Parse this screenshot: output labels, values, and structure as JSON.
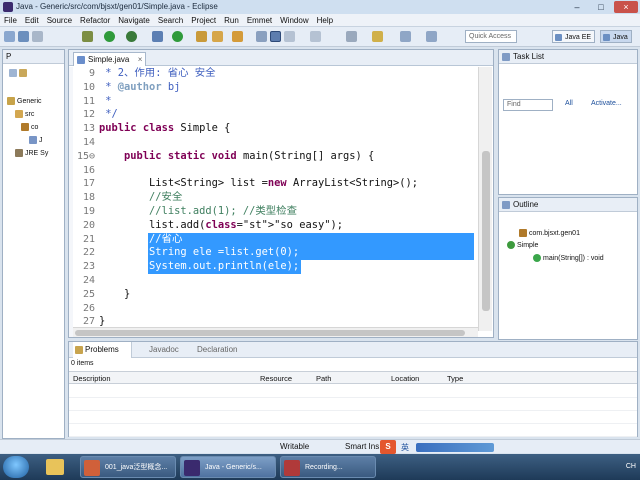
{
  "window": {
    "title": "Java - Generic/src/com/bjsxt/gen01/Simple.java - Eclipse",
    "min": "–",
    "max": "□",
    "close": "×"
  },
  "menu": [
    "File",
    "Edit",
    "Source",
    "Refactor",
    "Navigate",
    "Search",
    "Project",
    "Run",
    "Emmet",
    "Window",
    "Help"
  ],
  "toolbar": {
    "quick_access_placeholder": "Quick Access",
    "perspectives": [
      "Java EE",
      "Java"
    ]
  },
  "package_explorer": {
    "tab": "P",
    "items": [
      "Generic",
      "src",
      "co",
      "J",
      "JRE Sy"
    ]
  },
  "editor": {
    "tab": "Simple.java",
    "lines": [
      {
        "n": "9",
        "code": " * 2、作用: 省心 安全"
      },
      {
        "n": "10",
        "code": " * @author bj"
      },
      {
        "n": "11",
        "code": " *"
      },
      {
        "n": "12",
        "code": " */"
      },
      {
        "n": "13",
        "code": "public class Simple {"
      },
      {
        "n": "14",
        "code": ""
      },
      {
        "n": "15⊖",
        "code": "    public static void main(String[] args) {"
      },
      {
        "n": "16",
        "code": ""
      },
      {
        "n": "17",
        "code": "        List<String> list =new ArrayList<String>();"
      },
      {
        "n": "18",
        "code": "        //安全"
      },
      {
        "n": "19",
        "code": "        //list.add(1); //类型检查"
      },
      {
        "n": "20",
        "code": "        list.add(\"so easy\");"
      },
      {
        "n": "21",
        "code": "        //省心"
      },
      {
        "n": "22",
        "code": "        String ele =list.get(0);"
      },
      {
        "n": "23",
        "code": "        System.out.println(ele);"
      },
      {
        "n": "24",
        "code": ""
      },
      {
        "n": "25",
        "code": "    }"
      },
      {
        "n": "26",
        "code": ""
      },
      {
        "n": "27",
        "code": "}"
      }
    ]
  },
  "task_list": {
    "tab": "Task List",
    "find_placeholder": "Find",
    "all": "All",
    "activate": "Activate..."
  },
  "outline": {
    "tab": "Outline",
    "package": "com.bjsxt.gen01",
    "class": "Simple",
    "method": "main(String[]) : void"
  },
  "problems": {
    "tabs": [
      "Problems",
      "Javadoc",
      "Declaration"
    ],
    "count": "0 items",
    "columns": [
      "Description",
      "Resource",
      "Path",
      "Location",
      "Type"
    ]
  },
  "status": {
    "mode": "Writable",
    "insert": "Smart Ins",
    "ime": "英"
  },
  "taskbar": {
    "apps": [
      "001_java泛型概念...",
      "Java - Generic/s...",
      "Recording..."
    ],
    "tray": "CH"
  }
}
